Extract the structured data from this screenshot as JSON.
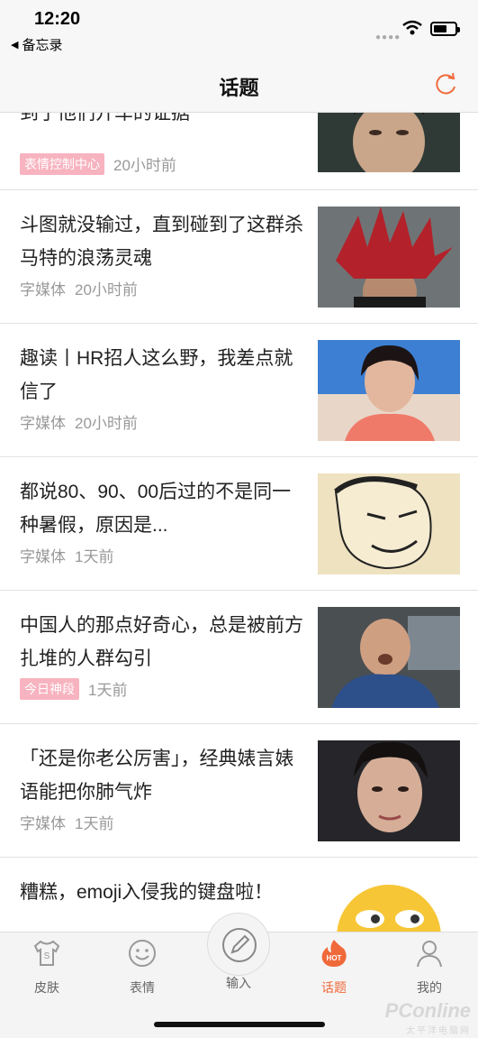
{
  "status": {
    "time": "12:20",
    "back_app": "备忘录"
  },
  "nav": {
    "title": "话题"
  },
  "articles": [
    {
      "title": "到了他们开车的证据",
      "tag": "表情控制中心",
      "source": "",
      "time": "20小时前"
    },
    {
      "title": "斗图就没输过，直到碰到了这群杀马特的浪荡灵魂",
      "tag": "",
      "source": "字媒体",
      "time": "20小时前"
    },
    {
      "title": "趣读丨HR招人这么野，我差点就信了",
      "tag": "",
      "source": "字媒体",
      "time": "20小时前"
    },
    {
      "title": "都说80、90、00后过的不是同一种暑假，原因是...",
      "tag": "",
      "source": "字媒体",
      "time": "1天前"
    },
    {
      "title": "中国人的那点好奇心，总是被前方扎堆的人群勾引",
      "tag": "今日神段",
      "source": "",
      "time": "1天前"
    },
    {
      "title": "「还是你老公厉害」，经典婊言婊语能把你肺气炸",
      "tag": "",
      "source": "字媒体",
      "time": "1天前"
    },
    {
      "title": "糟糕，emoji入侵我的键盘啦！",
      "tag": "",
      "source": "",
      "time": ""
    }
  ],
  "tabs": [
    {
      "label": "皮肤",
      "icon": "shirt-icon"
    },
    {
      "label": "表情",
      "icon": "smiley-icon"
    },
    {
      "label": "输入",
      "icon": "pen-icon"
    },
    {
      "label": "话题",
      "icon": "hot-icon"
    },
    {
      "label": "我的",
      "icon": "person-icon"
    }
  ],
  "watermark": {
    "line1": "PConline",
    "line2": "太平洋电脑网"
  },
  "colors": {
    "accent": "#f0693a",
    "tag_bg": "#f7b3bf"
  }
}
